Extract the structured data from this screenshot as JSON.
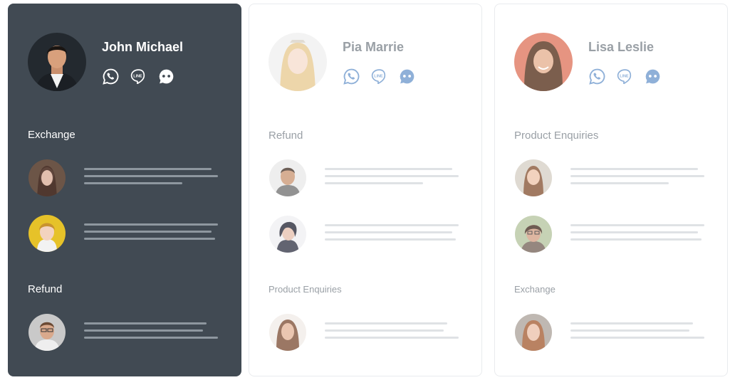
{
  "agents": [
    {
      "name": "John Michael",
      "active": true,
      "channel_icons": [
        "whatsapp-icon",
        "line-icon",
        "chat-bot-icon"
      ],
      "sections": [
        {
          "title": "Exchange",
          "tickets": 2
        },
        {
          "title": "Refund",
          "tickets": 1
        }
      ]
    },
    {
      "name": "Pia Marrie",
      "active": false,
      "channel_icons": [
        "whatsapp-icon",
        "line-icon",
        "chat-bot-icon"
      ],
      "sections": [
        {
          "title": "Refund",
          "tickets": 2
        },
        {
          "title": "Product Enquiries",
          "tickets": 1
        }
      ]
    },
    {
      "name": "Lisa Leslie",
      "active": false,
      "channel_icons": [
        "whatsapp-icon",
        "line-icon",
        "chat-bot-icon"
      ],
      "sections": [
        {
          "title": "Product Enquiries",
          "tickets": 2
        },
        {
          "title": "Exchange",
          "tickets": 1
        }
      ]
    }
  ],
  "colors": {
    "active_card_bg": "#414a53",
    "inactive_icon": "#8fb0d8",
    "active_icon": "#ffffff"
  }
}
